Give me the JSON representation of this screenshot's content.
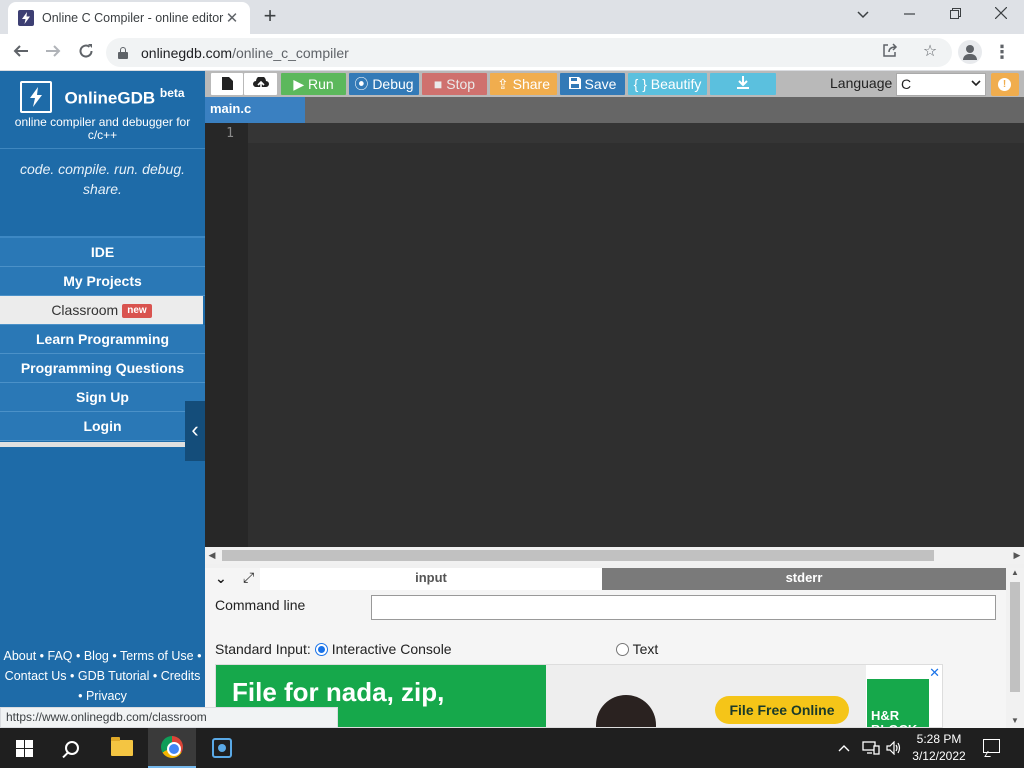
{
  "browser": {
    "tab_title": "Online C Compiler - online editor",
    "url_host": "onlinegdb.com",
    "url_path": "/online_c_compiler",
    "status_url": "https://www.onlinegdb.com/classroom"
  },
  "sidebar": {
    "brand_name": "OnlineGDB",
    "brand_sup": "beta",
    "brand_sub": "online compiler and debugger for c/c++",
    "tagline": "code. compile. run. debug. share.",
    "items": [
      {
        "label": "IDE"
      },
      {
        "label": "My Projects"
      },
      {
        "label": "Classroom",
        "badge": "new"
      },
      {
        "label": "Learn Programming"
      },
      {
        "label": "Programming Questions"
      },
      {
        "label": "Sign Up"
      },
      {
        "label": "Login"
      }
    ],
    "footer": {
      "about": "About",
      "faq": "FAQ",
      "blog": "Blog",
      "terms": "Terms of Use",
      "contact": "Contact Us",
      "gdb_tutorial": "GDB Tutorial",
      "credits": "Credits",
      "privacy": "Privacy"
    }
  },
  "toolbar": {
    "run": "Run",
    "debug": "Debug",
    "stop": "Stop",
    "share": "Share",
    "save": "Save",
    "beautify": "{ } Beautify",
    "language_label": "Language",
    "language_value": "C"
  },
  "editor": {
    "file_tab": "main.c",
    "line_numbers": [
      "1"
    ]
  },
  "console": {
    "tab_input": "input",
    "tab_stderr": "stderr",
    "command_line_label": "Command line",
    "command_line_value": "",
    "stdin_label": "Standard Input:",
    "option_interactive": "Interactive Console",
    "option_text": "Text",
    "selected_option": "Interactive Console"
  },
  "ad": {
    "headline": "File for nada, zip,",
    "cta": "File Free Online",
    "brand": "H&R BLOCK"
  },
  "taskbar": {
    "time": "5:28 PM",
    "date": "3/12/2022"
  },
  "colors": {
    "sidebar_bg": "#1e6ba8",
    "run_green": "#5cb85c",
    "debug_blue": "#337ab7",
    "stop_red": "#d9534f",
    "share_orange": "#f0ad4e",
    "beautify_cyan": "#5bc0de",
    "editor_bg": "#2f2f2f"
  }
}
